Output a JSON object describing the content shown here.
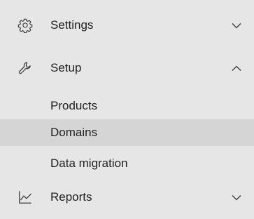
{
  "nav": {
    "settings": {
      "label": "Settings",
      "icon": "gear-icon",
      "expanded": false
    },
    "setup": {
      "label": "Setup",
      "icon": "wrench-icon",
      "expanded": true,
      "items": [
        {
          "label": "Products",
          "selected": false
        },
        {
          "label": "Domains",
          "selected": true
        },
        {
          "label": "Data migration",
          "selected": false
        }
      ]
    },
    "reports": {
      "label": "Reports",
      "icon": "line-chart-icon",
      "expanded": false
    }
  },
  "colors": {
    "background": "#e6e6e6",
    "selected_background": "#d5d5d5",
    "text": "#1f1f1f"
  }
}
